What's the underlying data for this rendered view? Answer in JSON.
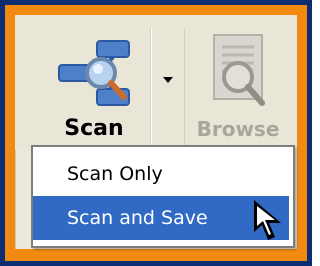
{
  "toolbar": {
    "scan_label": "Scan",
    "browse_label": "Browse",
    "scan_icon": "scanner-network-icon",
    "browse_icon": "document-magnifier-icon",
    "split_arrow_icon": "dropdown-arrow-icon"
  },
  "menu": {
    "items": [
      {
        "label": "Scan Only",
        "selected": false
      },
      {
        "label": "Scan and Save",
        "selected": true
      }
    ]
  },
  "colors": {
    "outer_frame": "#0d2d72",
    "inner_frame": "#f28a12",
    "panel_bg": "#ece9dc",
    "highlight": "#316ac5"
  }
}
